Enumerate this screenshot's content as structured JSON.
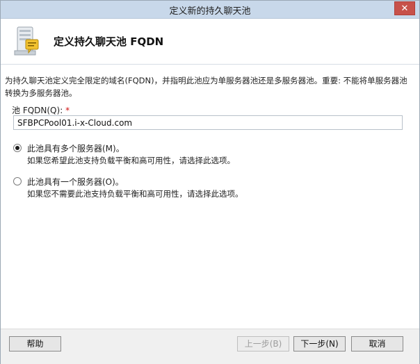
{
  "window": {
    "title": "定义新的持久聊天池",
    "close_glyph": "✕"
  },
  "header": {
    "title": "定义持久聊天池 FQDN",
    "icon": "server-chat-icon"
  },
  "content": {
    "description": "为持久聊天池定义完全限定的域名(FQDN)，并指明此池应为单服务器池还是多服务器池。重要: 不能将单服务器池转换为多服务器池。",
    "fqdn_label": "池 FQDN(Q):",
    "required_mark": "*",
    "fqdn_value": "SFBPCPool01.i-x-Cloud.com",
    "options": [
      {
        "label": "此池具有多个服务器(M)。",
        "description": "如果您希望此池支持负载平衡和高可用性，请选择此选项。",
        "selected": true
      },
      {
        "label": "此池具有一个服务器(O)。",
        "description": "如果您不需要此池支持负载平衡和高可用性，请选择此选项。",
        "selected": false
      }
    ]
  },
  "footer": {
    "help": "帮助",
    "back": "上一步(B)",
    "next": "下一步(N)",
    "cancel": "取消"
  },
  "colors": {
    "titlebar": "#c8d8ea",
    "close": "#c7514a",
    "required": "#d01010"
  }
}
